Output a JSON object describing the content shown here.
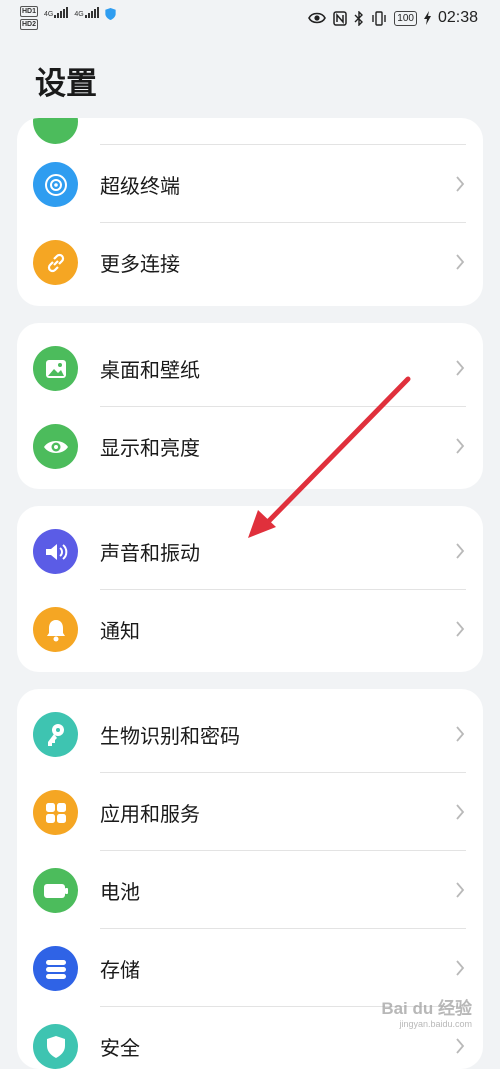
{
  "status_bar": {
    "sim1_label": "HD",
    "sim1_index": "1",
    "sim2_label": "HD",
    "sim2_index": "2",
    "net1": "4G",
    "net2": "4G",
    "battery": "100",
    "time": "02:38",
    "icons": [
      "eye-icon",
      "nfc-icon",
      "bluetooth-icon",
      "vibrate-icon",
      "battery-icon",
      "charging-icon"
    ]
  },
  "page": {
    "title": "设置"
  },
  "groups": [
    {
      "items": [
        {
          "label": "超级终端",
          "icon": "super-device-icon",
          "color": "#2f9df0"
        },
        {
          "label": "更多连接",
          "icon": "link-icon",
          "color": "#f5a623"
        }
      ]
    },
    {
      "items": [
        {
          "label": "桌面和壁纸",
          "icon": "wallpaper-icon",
          "color": "#4cbc5c"
        },
        {
          "label": "显示和亮度",
          "icon": "eye-display-icon",
          "color": "#4cbc5c"
        }
      ]
    },
    {
      "items": [
        {
          "label": "声音和振动",
          "icon": "speaker-icon",
          "color": "#5b5ce6"
        },
        {
          "label": "通知",
          "icon": "bell-icon",
          "color": "#f5a623"
        }
      ]
    },
    {
      "items": [
        {
          "label": "生物识别和密码",
          "icon": "key-icon",
          "color": "#3ec4b1"
        },
        {
          "label": "应用和服务",
          "icon": "apps-grid-icon",
          "color": "#f5a623"
        },
        {
          "label": "电池",
          "icon": "battery-settings-icon",
          "color": "#4cbc5c"
        },
        {
          "label": "存储",
          "icon": "storage-icon",
          "color": "#2f63e6"
        },
        {
          "label": "安全",
          "icon": "shield-icon",
          "color": "#3ec4b1"
        }
      ]
    }
  ],
  "annotation": {
    "arrow_color": "#e0303c"
  },
  "watermark": {
    "brand": "Bai du 经验",
    "url": "jingyan.baidu.com"
  }
}
